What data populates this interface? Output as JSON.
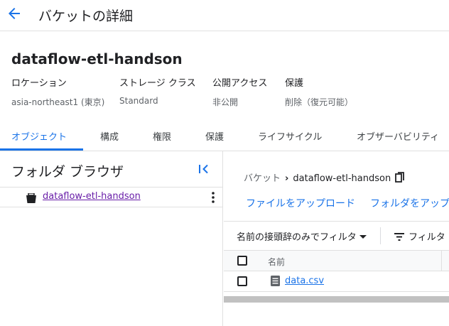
{
  "header": {
    "back_icon": "arrow-back-icon",
    "title": "バケットの詳細"
  },
  "bucket": {
    "name": "dataflow-etl-handson",
    "fields": [
      {
        "label": "ロケーション",
        "value": "asia-northeast1 (東京)"
      },
      {
        "label": "ストレージ クラス",
        "value": "Standard"
      },
      {
        "label": "公開アクセス",
        "value": "非公開"
      },
      {
        "label": "保護",
        "value": "削除（復元可能）"
      }
    ]
  },
  "tabs": [
    {
      "label": "オブジェクト",
      "active": true
    },
    {
      "label": "構成",
      "active": false
    },
    {
      "label": "権限",
      "active": false
    },
    {
      "label": "保護",
      "active": false
    },
    {
      "label": "ライフサイクル",
      "active": false
    },
    {
      "label": "オブザーバビリティ",
      "active": false
    }
  ],
  "folder_browser": {
    "title": "フォルダ ブラウザ",
    "collapse_icon": "collapse-left-icon",
    "tree": [
      {
        "label": "dataflow-etl-handson",
        "icon": "bucket-icon",
        "menu_icon": "more-vert-icon"
      }
    ]
  },
  "objects": {
    "breadcrumb": {
      "root": "バケット",
      "current": "dataflow-etl-handson",
      "copy_icon": "copy-icon"
    },
    "actions": {
      "upload_files": "ファイルをアップロード",
      "upload_folder": "フォルダをアップロ"
    },
    "filter": {
      "prefix_label": "名前の接頭辞のみでフィルタ",
      "filter_label": "フィルタ"
    },
    "table": {
      "columns": [
        "名前"
      ],
      "rows": [
        {
          "name": "data.csv",
          "icon": "file-icon"
        }
      ]
    }
  },
  "colors": {
    "accent": "#1a73e8",
    "visited_link": "#681da8",
    "border": "#e0e0e0"
  }
}
